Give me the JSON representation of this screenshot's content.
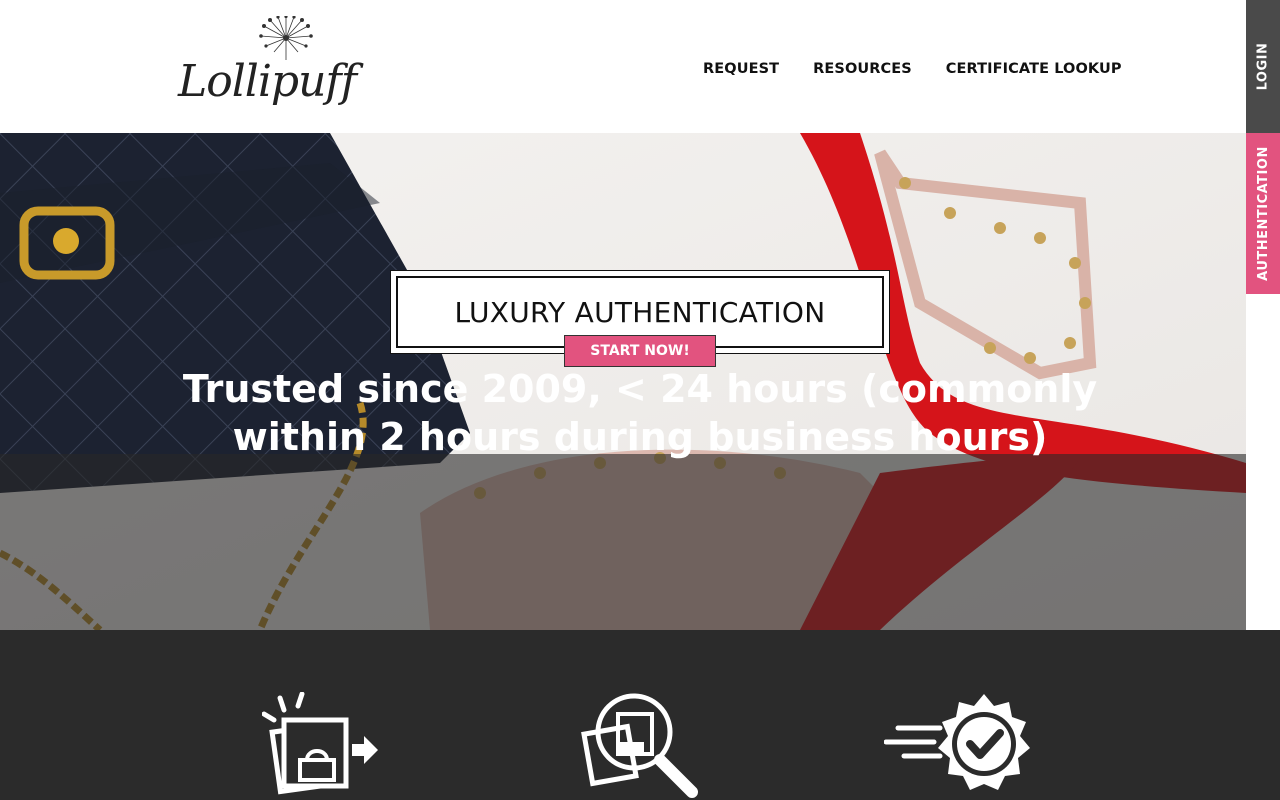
{
  "brand": {
    "name": "Lollipuff"
  },
  "nav": {
    "items": [
      "REQUEST",
      "RESOURCES",
      "CERTIFICATE LOOKUP"
    ]
  },
  "side_tabs": {
    "login": "LOGIN",
    "authentication": "AUTHENTICATION"
  },
  "hero": {
    "title": "LUXURY AUTHENTICATION",
    "cta": "START NOW!",
    "tagline_line1": "Trusted since 2009, < 24 hours (commonly",
    "tagline_line2": "within 2 hours during business hours)"
  },
  "steps": {
    "icons": [
      "upload-photos-icon",
      "inspect-magnifier-icon",
      "fast-verified-icon"
    ]
  },
  "colors": {
    "accent": "#e2537f",
    "dark": "#2b2b2b",
    "side_dark": "#4a4a4a"
  }
}
